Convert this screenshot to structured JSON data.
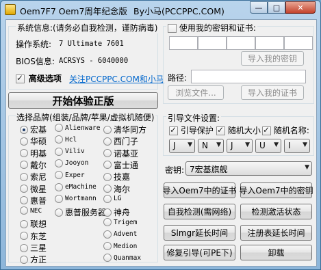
{
  "window": {
    "title": "Oem7F7 Oem7周年纪念版",
    "author": "By小马(PCCPPC.COM)",
    "controls": {
      "minimize": "—",
      "maximize": "□",
      "close": "✕"
    }
  },
  "sysinfo": {
    "header": "系统信息:(请务必自我检测，谨防病毒)",
    "os_label": "操作系统:",
    "os_value": "7 Ultimate 7601",
    "bios_label": "BIOS信息:",
    "bios_value": "ACRSYS - 6040000",
    "advanced_label": "高级选项",
    "follow_link": "关注PCCPPC.COM和小马"
  },
  "start_button": "开始体验正版",
  "brand_section": {
    "header": "选择品牌(组装/品牌/苹果/虚拟机随便)",
    "col1": [
      "宏基",
      "华硕",
      "明基",
      "戴尔",
      "索尼",
      "微星",
      "惠普",
      "NEC",
      "联想",
      "东芝",
      "三星",
      "方正"
    ],
    "col2": [
      "Alienware",
      "Hcl",
      "Viliv",
      "Jooyon",
      "Exper",
      "eMachine",
      "Wortmann",
      "惠普服务器"
    ],
    "col3": [
      "清华同方",
      "西门子",
      "诺基亚",
      "富士通",
      "技嘉",
      "海尔",
      "LG",
      "神舟",
      "Trigem",
      "Advent",
      "Medion",
      "Quanmax"
    ]
  },
  "cert": {
    "use_own_label": "使用我的密钥和证书:",
    "import_key_btn": "导入我的密钥",
    "path_label": "路径:",
    "browse_btn": "浏览文件...",
    "import_cert_btn": "导入我的证书"
  },
  "boot": {
    "header": "引导文件设置:",
    "protect_label": "引导保护",
    "random_size_label": "随机大小",
    "random_name_label": "随机名称:",
    "letters": [
      "J",
      "N",
      "J",
      "U",
      "I"
    ]
  },
  "key": {
    "label": "密钥:",
    "selected": "7宏基旗舰"
  },
  "actions": {
    "import_oem_cert": "导入Oem7中的证书",
    "import_oem_key": "导入Oem7中的密钥",
    "self_check": "自我检测(需网络)",
    "check_activation": "检测激活状态",
    "slmgr_extend": "Slmgr延长时间",
    "registry_extend": "注册表延长时间",
    "repair_boot": "修复引导(可PE下)",
    "uninstall": "卸载"
  },
  "colors": {
    "link": "#0066cc",
    "titlebar": "#8db6da"
  }
}
